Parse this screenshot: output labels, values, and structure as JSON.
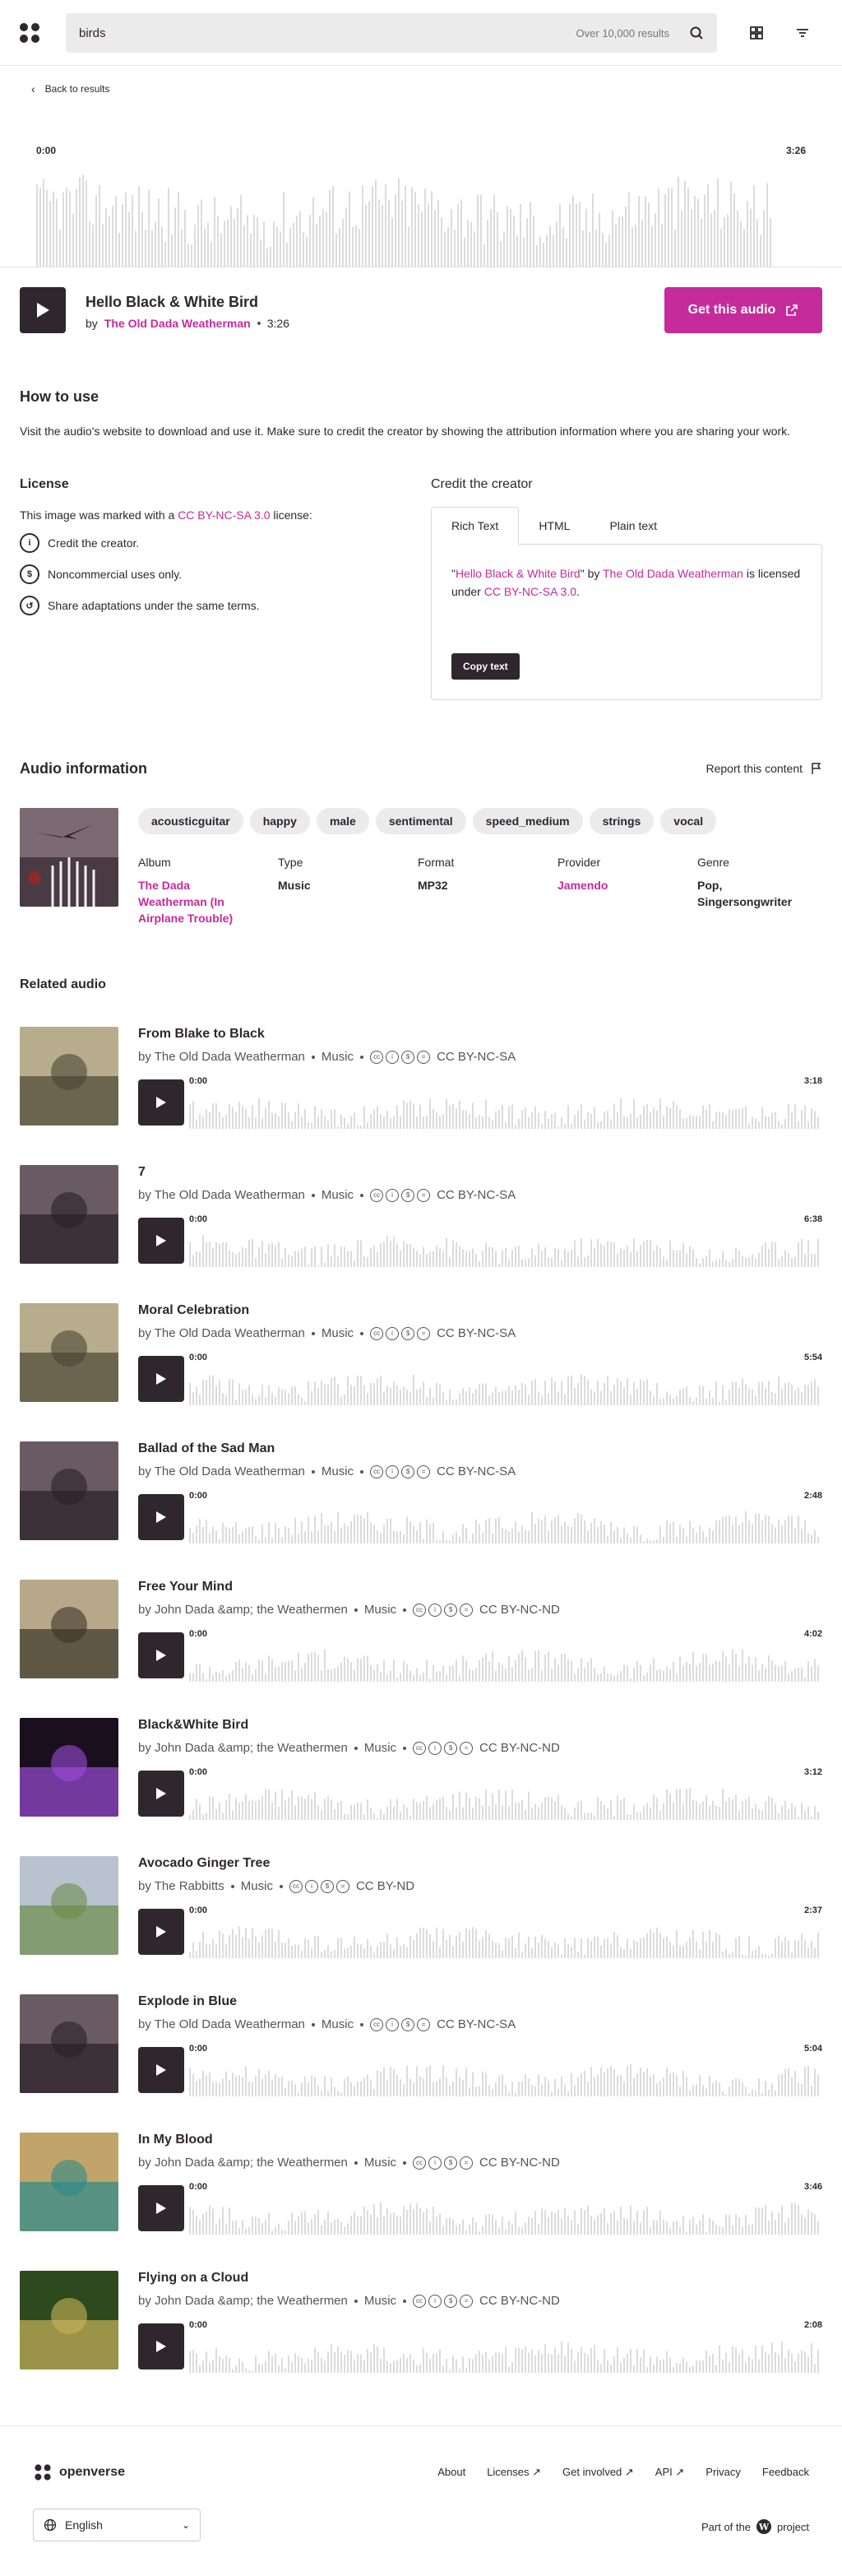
{
  "search": {
    "query": "birds",
    "hint": "Over 10,000 results"
  },
  "nav": {
    "back_label": "Back to results"
  },
  "audio": {
    "title": "Hello Black & White Bird",
    "by": "by",
    "creator": "The Old Dada Weatherman",
    "duration": "3:26",
    "time_start": "0:00",
    "get_label": "Get this audio"
  },
  "how_to_use": {
    "title": "How to use",
    "text": "Visit the audio's website to download and use it. Make sure to credit the creator by showing the attribution information where you are sharing your work."
  },
  "license": {
    "title": "License",
    "intro_pre": "This image was marked with a ",
    "name": "CC BY-NC-SA 3.0",
    "intro_post": " license:",
    "items": [
      "Credit the creator.",
      "Noncommercial uses only.",
      "Share adaptations under the same terms."
    ]
  },
  "credit": {
    "title": "Credit the creator",
    "tabs": [
      "Rich Text",
      "HTML",
      "Plain text"
    ],
    "q1": "\"",
    "work": "Hello Black & White Bird",
    "q2": "\" by ",
    "creator": "The Old Dada Weatherman",
    "mid": " is licensed under ",
    "license": "CC BY-NC-SA 3.0",
    "end": ".",
    "copy_label": "Copy text"
  },
  "info": {
    "title": "Audio information",
    "report": "Report this content",
    "tags": [
      "acousticguitar",
      "happy",
      "male",
      "sentimental",
      "speed_medium",
      "strings",
      "vocal"
    ],
    "meta": {
      "album_k": "Album",
      "album_v": "The Dada Weatherman (In Airplane Trouble)",
      "type_k": "Type",
      "type_v": "Music",
      "format_k": "Format",
      "format_v": "MP32",
      "provider_k": "Provider",
      "provider_v": "Jamendo",
      "genre_k": "Genre",
      "genre_v": "Pop, Singersongwriter"
    }
  },
  "related": {
    "title": "Related audio",
    "items": [
      {
        "title": "From Blake to Black",
        "by": "by The Old Dada Weatherman",
        "type": "Music",
        "license": "CC BY-NC-SA",
        "start": "0:00",
        "dur": "3:18"
      },
      {
        "title": "7",
        "by": "by The Old Dada Weatherman",
        "type": "Music",
        "license": "CC BY-NC-SA",
        "start": "0:00",
        "dur": "6:38"
      },
      {
        "title": "Moral Celebration",
        "by": "by The Old Dada Weatherman",
        "type": "Music",
        "license": "CC BY-NC-SA",
        "start": "0:00",
        "dur": "5:54"
      },
      {
        "title": "Ballad of the Sad Man",
        "by": "by The Old Dada Weatherman",
        "type": "Music",
        "license": "CC BY-NC-SA",
        "start": "0:00",
        "dur": "2:48"
      },
      {
        "title": "Free Your Mind",
        "by": "by John Dada &amp; the Weathermen",
        "type": "Music",
        "license": "CC BY-NC-ND",
        "start": "0:00",
        "dur": "4:02"
      },
      {
        "title": "Black&White Bird",
        "by": "by John Dada &amp; the Weathermen",
        "type": "Music",
        "license": "CC BY-NC-ND",
        "start": "0:00",
        "dur": "3:12"
      },
      {
        "title": "Avocado Ginger Tree",
        "by": "by The Rabbitts",
        "type": "Music",
        "license": "CC BY-ND",
        "start": "0:00",
        "dur": "2:37"
      },
      {
        "title": "Explode in Blue",
        "by": "by The Old Dada Weatherman",
        "type": "Music",
        "license": "CC BY-NC-SA",
        "start": "0:00",
        "dur": "5:04"
      },
      {
        "title": "In My Blood",
        "by": "by John Dada &amp; the Weathermen",
        "type": "Music",
        "license": "CC BY-NC-ND",
        "start": "0:00",
        "dur": "3:46"
      },
      {
        "title": "Flying on a Cloud",
        "by": "by John Dada &amp; the Weathermen",
        "type": "Music",
        "license": "CC BY-NC-ND",
        "start": "0:00",
        "dur": "2:08"
      }
    ]
  },
  "footer": {
    "brand": "openverse",
    "links": [
      "About",
      "Licenses",
      "Get involved",
      "API",
      "Privacy",
      "Feedback"
    ],
    "language": "English",
    "part_of": "Part of the",
    "project": "project"
  },
  "colors": {
    "accent": "#c52b9b",
    "dark": "#30272e",
    "wave": "#dcdcdc"
  }
}
